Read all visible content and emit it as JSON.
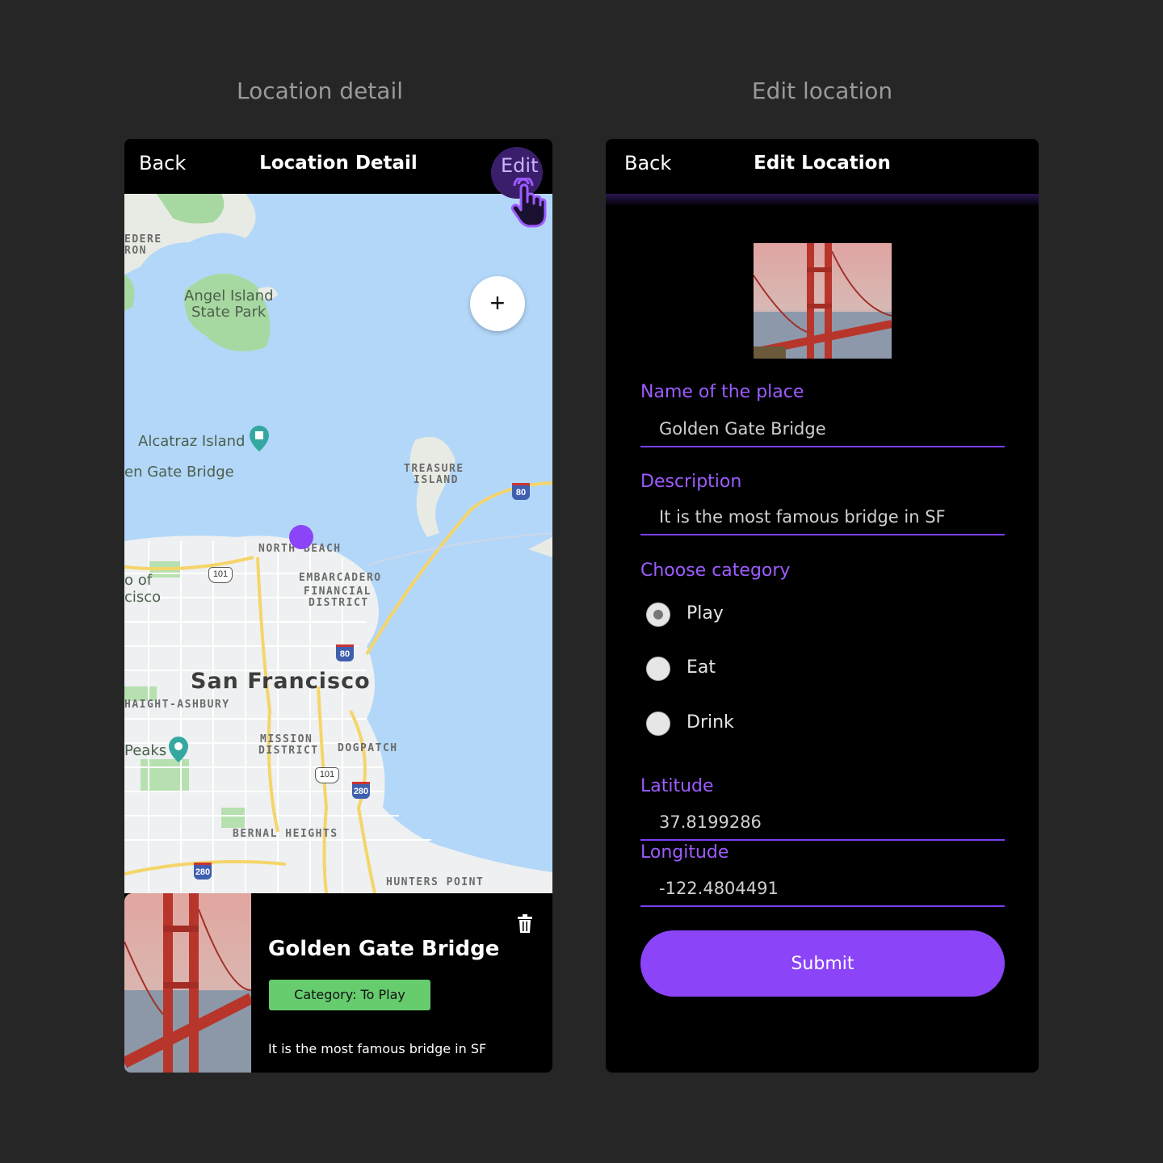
{
  "captions": {
    "left": "Location detail",
    "right": "Edit location"
  },
  "detail": {
    "nav": {
      "back": "Back",
      "title": "Location Detail",
      "edit": "Edit"
    },
    "zoom_label": "+",
    "map_labels": {
      "belvedere_top": "EDERE",
      "belvedere_bottom": "RON",
      "angel_island_1": "Angel Island",
      "angel_island_2": "State Park",
      "alcatraz": "Alcatraz Island",
      "golden_gate": "en Gate Bridge",
      "treasure_1": "TREASURE",
      "treasure_2": "ISLAND",
      "north_beach": "NORTH BEACH",
      "embarcadero": "EMBARCADERO",
      "financial_1": "FINANCIAL",
      "financial_2": "DISTRICT",
      "sf_partial_1": "o of",
      "sf_partial_2": "cisco",
      "city": "San Francisco",
      "haight": "HAIGHT-ASHBURY",
      "peaks": "Peaks",
      "mission_1": "MISSION",
      "mission_2": "DISTRICT",
      "dogpatch": "DOGPATCH",
      "bernal": "BERNAL HEIGHTS",
      "hunters": "HUNTERS POINT",
      "route_80_a": "80",
      "route_80_b": "80",
      "route_101_a": "101",
      "route_101_b": "101",
      "route_280_a": "280",
      "route_280_b": "280"
    },
    "card": {
      "title": "Golden Gate Bridge",
      "category": "Category: To Play",
      "description": "It is the most famous bridge in SF"
    }
  },
  "edit": {
    "nav": {
      "back": "Back",
      "title": "Edit Location"
    },
    "name_label": "Name of the place",
    "name_value": "Golden Gate Bridge",
    "description_label": "Description",
    "description_value": "It is the most famous bridge in SF",
    "category_label": "Choose category",
    "categories": [
      {
        "label": "Play",
        "selected": true
      },
      {
        "label": "Eat",
        "selected": false
      },
      {
        "label": "Drink",
        "selected": false
      }
    ],
    "latitude_label": "Latitude",
    "latitude_value": "37.8199286",
    "longitude_label": "Longitude",
    "longitude_value": "-122.4804491",
    "submit_label": "Submit"
  },
  "colors": {
    "accent": "#8b44f7",
    "badge": "#66cc6e",
    "water": "#b3d7f9",
    "background": "#262626"
  },
  "icons": [
    "hand-pointer-icon",
    "plus-icon",
    "location-pin-icon",
    "trash-icon",
    "attraction-icon",
    "camera-icon"
  ]
}
